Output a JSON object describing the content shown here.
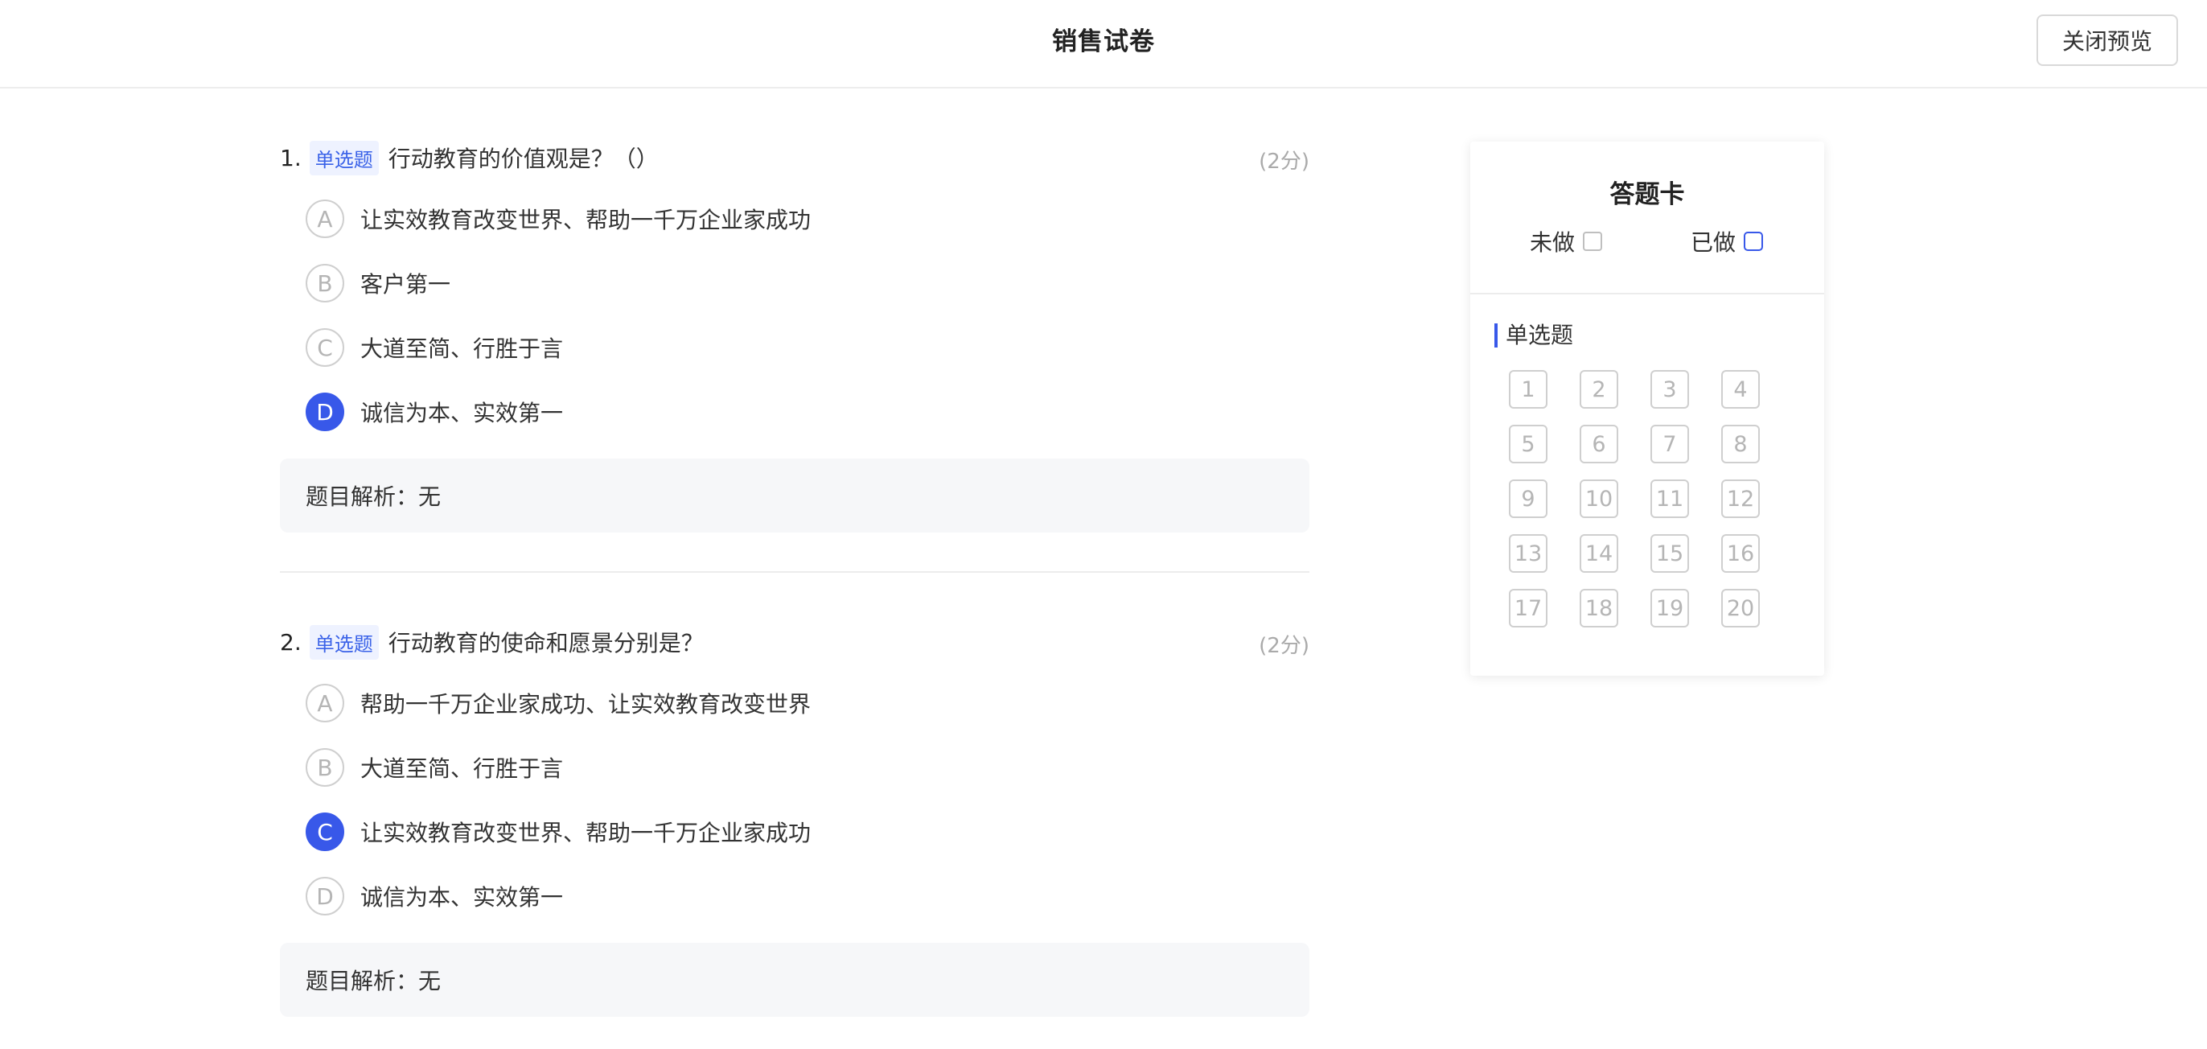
{
  "header": {
    "title": "销售试卷",
    "close_label": "关闭预览"
  },
  "questions": [
    {
      "number": "1.",
      "type": "单选题",
      "text": "行动教育的价值观是？（）",
      "score": "(2分)",
      "options": [
        {
          "letter": "A",
          "text": "让实效教育改变世界、帮助一千万企业家成功",
          "selected": false
        },
        {
          "letter": "B",
          "text": "客户第一",
          "selected": false
        },
        {
          "letter": "C",
          "text": "大道至简、行胜于言",
          "selected": false
        },
        {
          "letter": "D",
          "text": "诚信为本、实效第一",
          "selected": true
        }
      ],
      "analysis": "题目解析：无"
    },
    {
      "number": "2.",
      "type": "单选题",
      "text": "行动教育的使命和愿景分别是？",
      "score": "(2分)",
      "options": [
        {
          "letter": "A",
          "text": "帮助一千万企业家成功、让实效教育改变世界",
          "selected": false
        },
        {
          "letter": "B",
          "text": "大道至简、行胜于言",
          "selected": false
        },
        {
          "letter": "C",
          "text": "让实效教育改变世界、帮助一千万企业家成功",
          "selected": true
        },
        {
          "letter": "D",
          "text": "诚信为本、实效第一",
          "selected": false
        }
      ],
      "analysis": "题目解析：无"
    }
  ],
  "answer_card": {
    "title": "答题卡",
    "legend_undone": "未做",
    "legend_done": "已做",
    "section_label": "单选题",
    "numbers": [
      "1",
      "2",
      "3",
      "4",
      "5",
      "6",
      "7",
      "8",
      "9",
      "10",
      "11",
      "12",
      "13",
      "14",
      "15",
      "16",
      "17",
      "18",
      "19",
      "20"
    ]
  },
  "colors": {
    "accent": "#3858e9",
    "tag_bg": "#eef2ff",
    "analysis_bg": "#f6f7f9"
  }
}
